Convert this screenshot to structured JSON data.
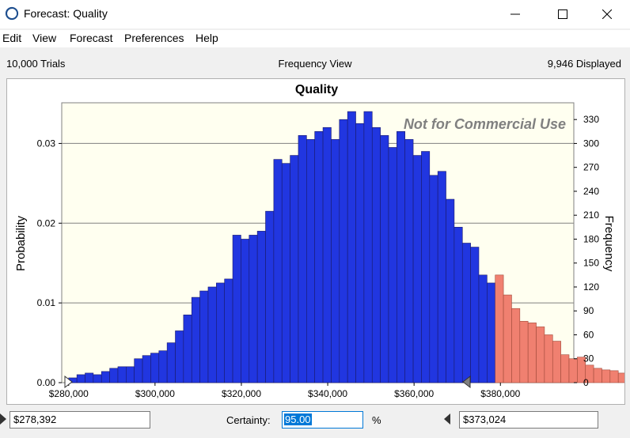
{
  "window": {
    "title": "Forecast: Quality",
    "icon": "app-spiral-icon",
    "controls": [
      "minimize-icon",
      "maximize-icon",
      "close-icon"
    ]
  },
  "menu": [
    "Edit",
    "View",
    "Forecast",
    "Preferences",
    "Help"
  ],
  "info": {
    "trials": "10,000 Trials",
    "view": "Frequency View",
    "displayed": "9,946 Displayed"
  },
  "chart": {
    "watermark": "Not for Commercial Use",
    "colors": {
      "plot_bg": "#fffff0",
      "bar_main": "#2136e0",
      "bar_tail": "#f08070",
      "bar_edge": "#1a1a6a"
    }
  },
  "chart_data": {
    "type": "bar",
    "title": "Quality",
    "xlabel": "",
    "ylabel": "Probability",
    "y2label": "Frequency",
    "x_ticks": [
      "$280,000",
      "$300,000",
      "$320,000",
      "$340,000",
      "$360,000",
      "$380,000"
    ],
    "x_tick_values": [
      280000,
      300000,
      320000,
      340000,
      360000,
      380000
    ],
    "xlim": [
      278392,
      397000
    ],
    "y_ticks": [
      "0.00",
      "0.01",
      "0.02",
      "0.03"
    ],
    "ylim": [
      0,
      0.0351
    ],
    "y2_ticks": [
      "0",
      "30",
      "60",
      "90",
      "120",
      "150",
      "180",
      "210",
      "240",
      "270",
      "300",
      "330"
    ],
    "y2lim": [
      0,
      351
    ],
    "bin_width": 1900,
    "first_bin_start": 280000,
    "frequencies": [
      6,
      10,
      12,
      10,
      14,
      18,
      20,
      20,
      30,
      34,
      37,
      40,
      50,
      65,
      85,
      107,
      115,
      120,
      125,
      130,
      185,
      180,
      185,
      190,
      215,
      280,
      275,
      285,
      310,
      305,
      315,
      320,
      305,
      330,
      340,
      325,
      340,
      320,
      310,
      295,
      315,
      305,
      285,
      290,
      260,
      265,
      230,
      195,
      175,
      170,
      135,
      125,
      135,
      110,
      93,
      77,
      75,
      70,
      60,
      52,
      35,
      30,
      32,
      22,
      18,
      16,
      15,
      12,
      15,
      14
    ],
    "tail_start_bin": 52,
    "certainty_range": [
      278392,
      373024
    ]
  },
  "bottom": {
    "left_value": "$278,392",
    "certainty_label": "Certainty:",
    "certainty_value": "95.00",
    "percent": "%",
    "right_value": "$373,024"
  }
}
